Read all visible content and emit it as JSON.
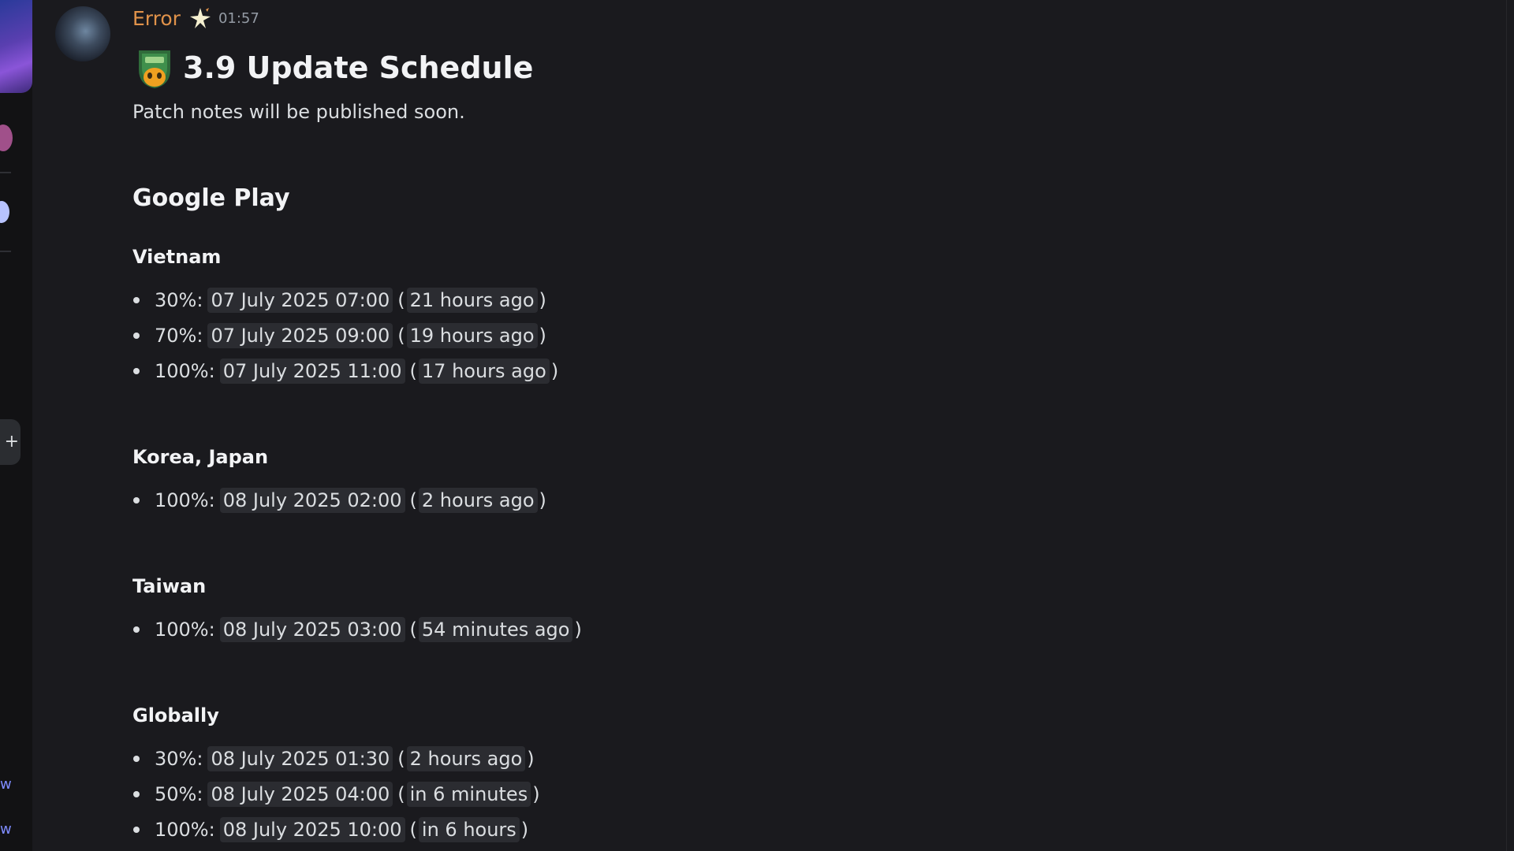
{
  "message": {
    "username": "Error",
    "timestamp": "01:57",
    "title": "3.9 Update Schedule",
    "subtitle": "Patch notes will be published soon.",
    "store": "Google Play",
    "sections": [
      {
        "region": "Vietnam",
        "items": [
          {
            "percent": "30%:",
            "date": "07 July 2025 07:00",
            "relative": "21 hours ago"
          },
          {
            "percent": "70%:",
            "date": "07 July 2025 09:00",
            "relative": "19 hours ago"
          },
          {
            "percent": "100%:",
            "date": "07 July 2025 11:00",
            "relative": "17 hours ago"
          }
        ]
      },
      {
        "region": "Korea, Japan",
        "items": [
          {
            "percent": "100%:",
            "date": "08 July 2025 02:00",
            "relative": "2 hours ago"
          }
        ]
      },
      {
        "region": "Taiwan",
        "items": [
          {
            "percent": "100%:",
            "date": "08 July 2025 03:00",
            "relative": "54 minutes ago"
          }
        ]
      },
      {
        "region": "Globally",
        "items": [
          {
            "percent": "30%:",
            "date": "08 July 2025 01:30",
            "relative": "2 hours ago"
          },
          {
            "percent": "50%:",
            "date": "08 July 2025 04:00",
            "relative": "in 6 minutes"
          },
          {
            "percent": "100%:",
            "date": "08 July 2025 10:00",
            "relative": "in 6 hours"
          }
        ]
      }
    ]
  },
  "rail": {
    "add_icon": "+",
    "link_fragments": [
      "w",
      "w"
    ]
  },
  "colors": {
    "username": "#e0924a",
    "background": "#1a1a1e",
    "chip": "#2b2c31",
    "text": "#dbdee1"
  }
}
